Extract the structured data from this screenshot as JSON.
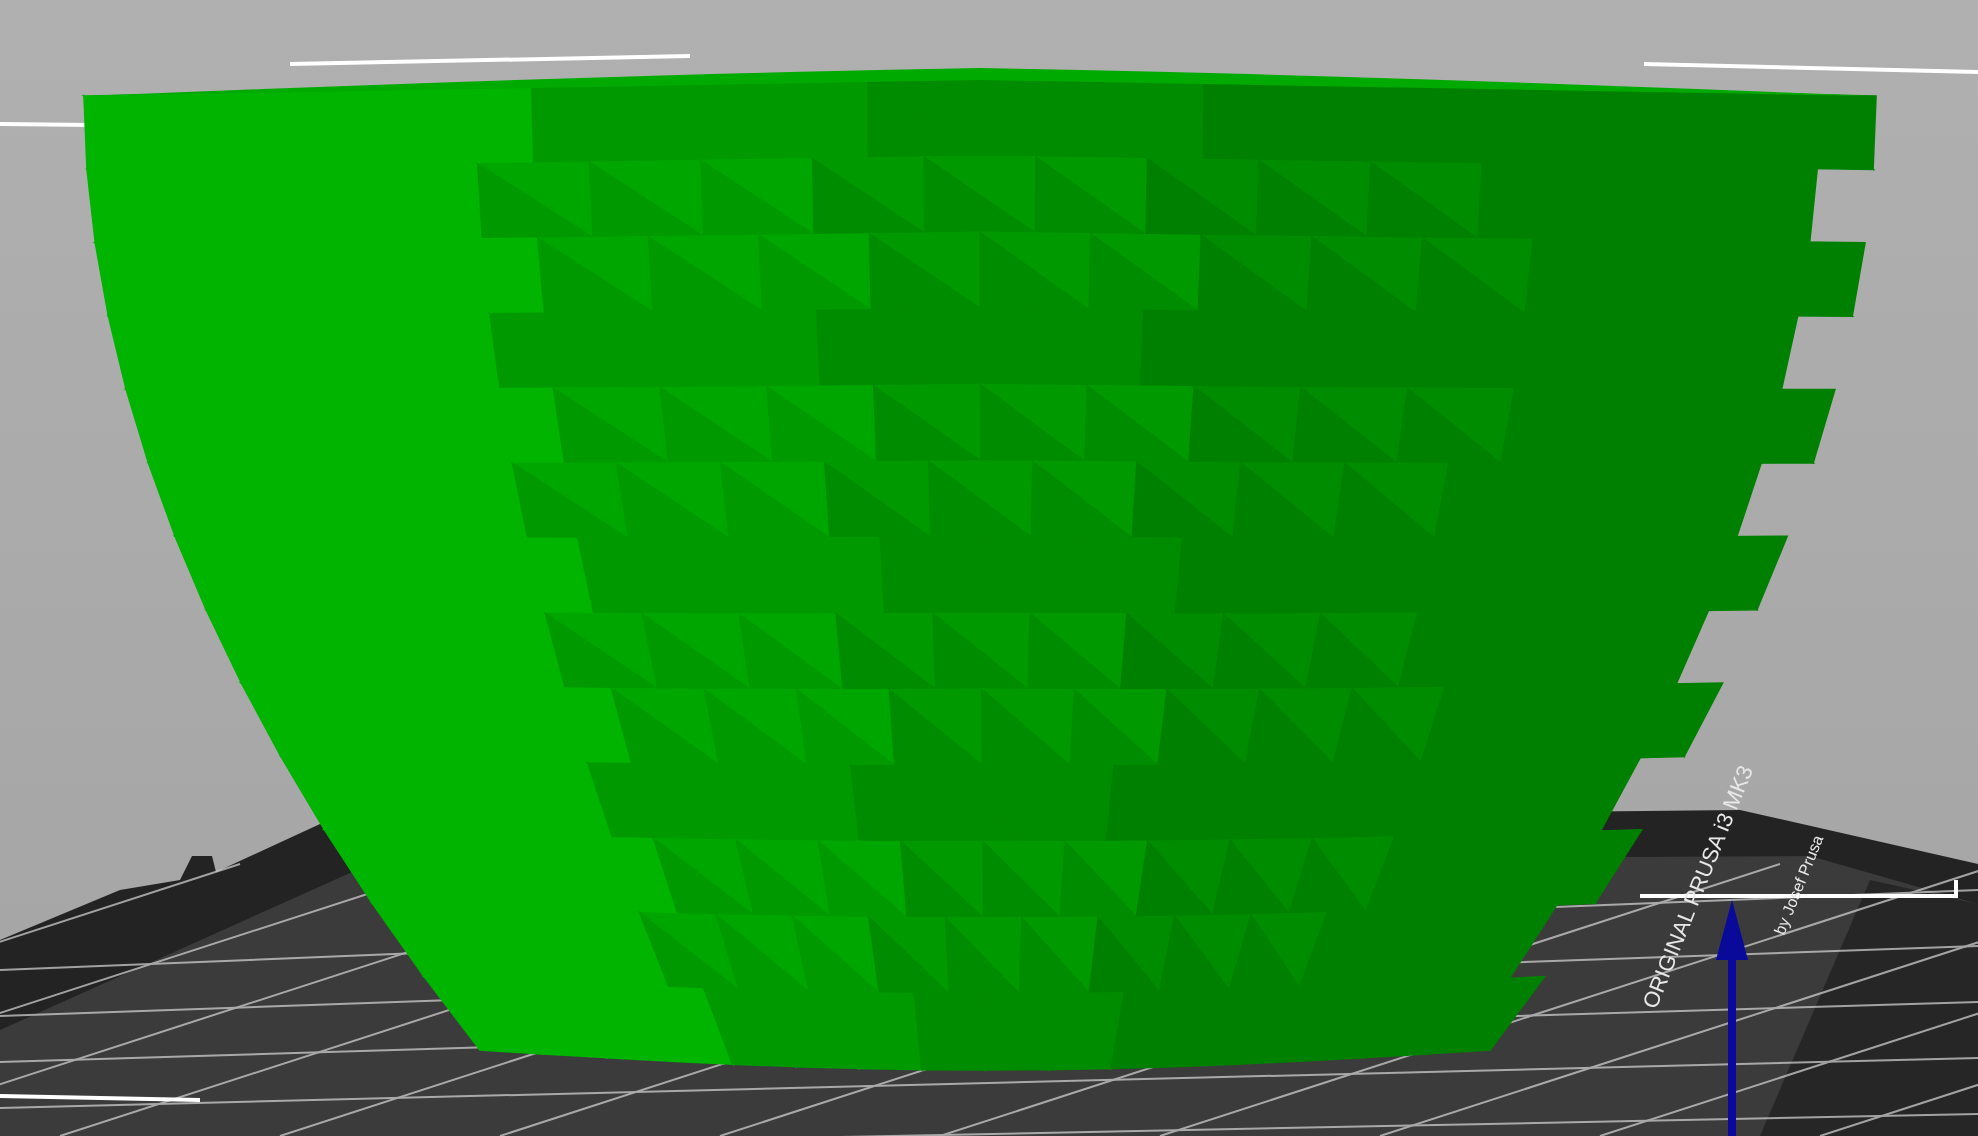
{
  "bed_label": {
    "lines": [
      "ORIGINAL PRUSA i3 MK3",
      "by Josef Prusa"
    ]
  }
}
